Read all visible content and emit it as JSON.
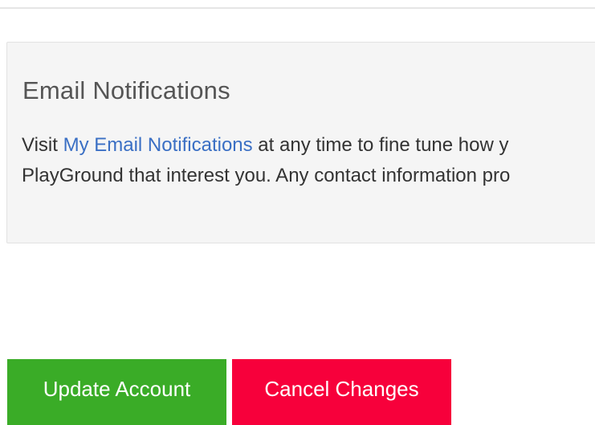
{
  "email_notifications": {
    "title": "Email Notifications",
    "line1_prefix": "Visit ",
    "link_text": "My Email Notifications",
    "line1_suffix": " at any time to fine tune how y",
    "line2": "PlayGround that interest you. Any contact information pro"
  },
  "actions": {
    "update_label": "Update Account",
    "cancel_label": "Cancel Changes"
  },
  "colors": {
    "update_button": "#3aac27",
    "cancel_button": "#f7003b",
    "link": "#3a6fc4",
    "panel_background": "#f5f5f5"
  }
}
